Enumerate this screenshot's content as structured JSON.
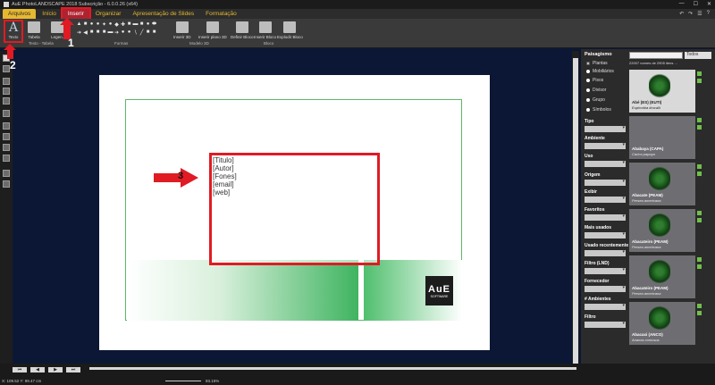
{
  "window": {
    "title": "AuE PhotoLANDSCAPE 2018 Subscrição - 6.0.0.26 (x64)",
    "controls": [
      "—",
      "☐",
      "✕"
    ]
  },
  "menu": {
    "tabs": [
      "Arquivos",
      "Início",
      "Inserir",
      "Organizar",
      "Apresentação de Slides",
      "Formatação"
    ],
    "active_tab": "Inserir"
  },
  "ribbon": {
    "texto_label": "Texto",
    "tabela_label": "Tabela",
    "legenda_label": "Legen.",
    "inserir_3d_label": "Inserir 3D",
    "inserir_plano_label": "Inserir plano 3D",
    "definir_bloco_label": "Definir Bloco",
    "inserir_bloco_label": "Inserir Bloco",
    "explodir_bloco_label": "Explodir Bloco",
    "groups": {
      "textos": "Texto - Tabela",
      "formas": "Formas",
      "modelo3d": "Modelo 3D",
      "bloco": "Bloco"
    }
  },
  "callouts": [
    "1",
    "2",
    "3"
  ],
  "canvas": {
    "textbox_lines": [
      "[Titulo]",
      "[Autor]",
      "[Fones]",
      "[email]",
      "[web]"
    ],
    "logo_text": "AuE",
    "logo_sub": "SOFTWARE"
  },
  "status": {
    "coords": "X: 109.52 Y: 99.47 cm",
    "zoom": "93.16%"
  },
  "right_panel": {
    "title": "Paisagismo",
    "filter_value": "Todos",
    "count_text": "22007 nomes de 2905 itens ...",
    "radios": [
      "Plantas",
      "Mobiliários",
      "Pisos",
      "Divisor",
      "Grupo",
      "Símbolos"
    ],
    "filters": [
      "Tipo",
      "Ambiente",
      "Uso",
      "Origem",
      "Exibir",
      "Favoritos",
      "Mais usados",
      "Usado recentemente",
      "Filtro (LND)",
      "Fornecedor",
      "# Ambientes",
      "Filtro"
    ],
    "cards": [
      {
        "name": "Abé (ES) (EUTI)",
        "sci": "Euphorbia tirucalli"
      },
      {
        "name": "Ababaya (CAPA)",
        "sci": "Carica papaya"
      },
      {
        "name": "Abacate (PEAM)",
        "sci": "Persea americana"
      },
      {
        "name": "Abacateiro (PEAM)",
        "sci": "Persea americana"
      },
      {
        "name": "Abacateiro (PEAM)",
        "sci": "Persea americana"
      },
      {
        "name": "Abacaxi (ANCO)",
        "sci": "Ananas comosus"
      }
    ]
  }
}
